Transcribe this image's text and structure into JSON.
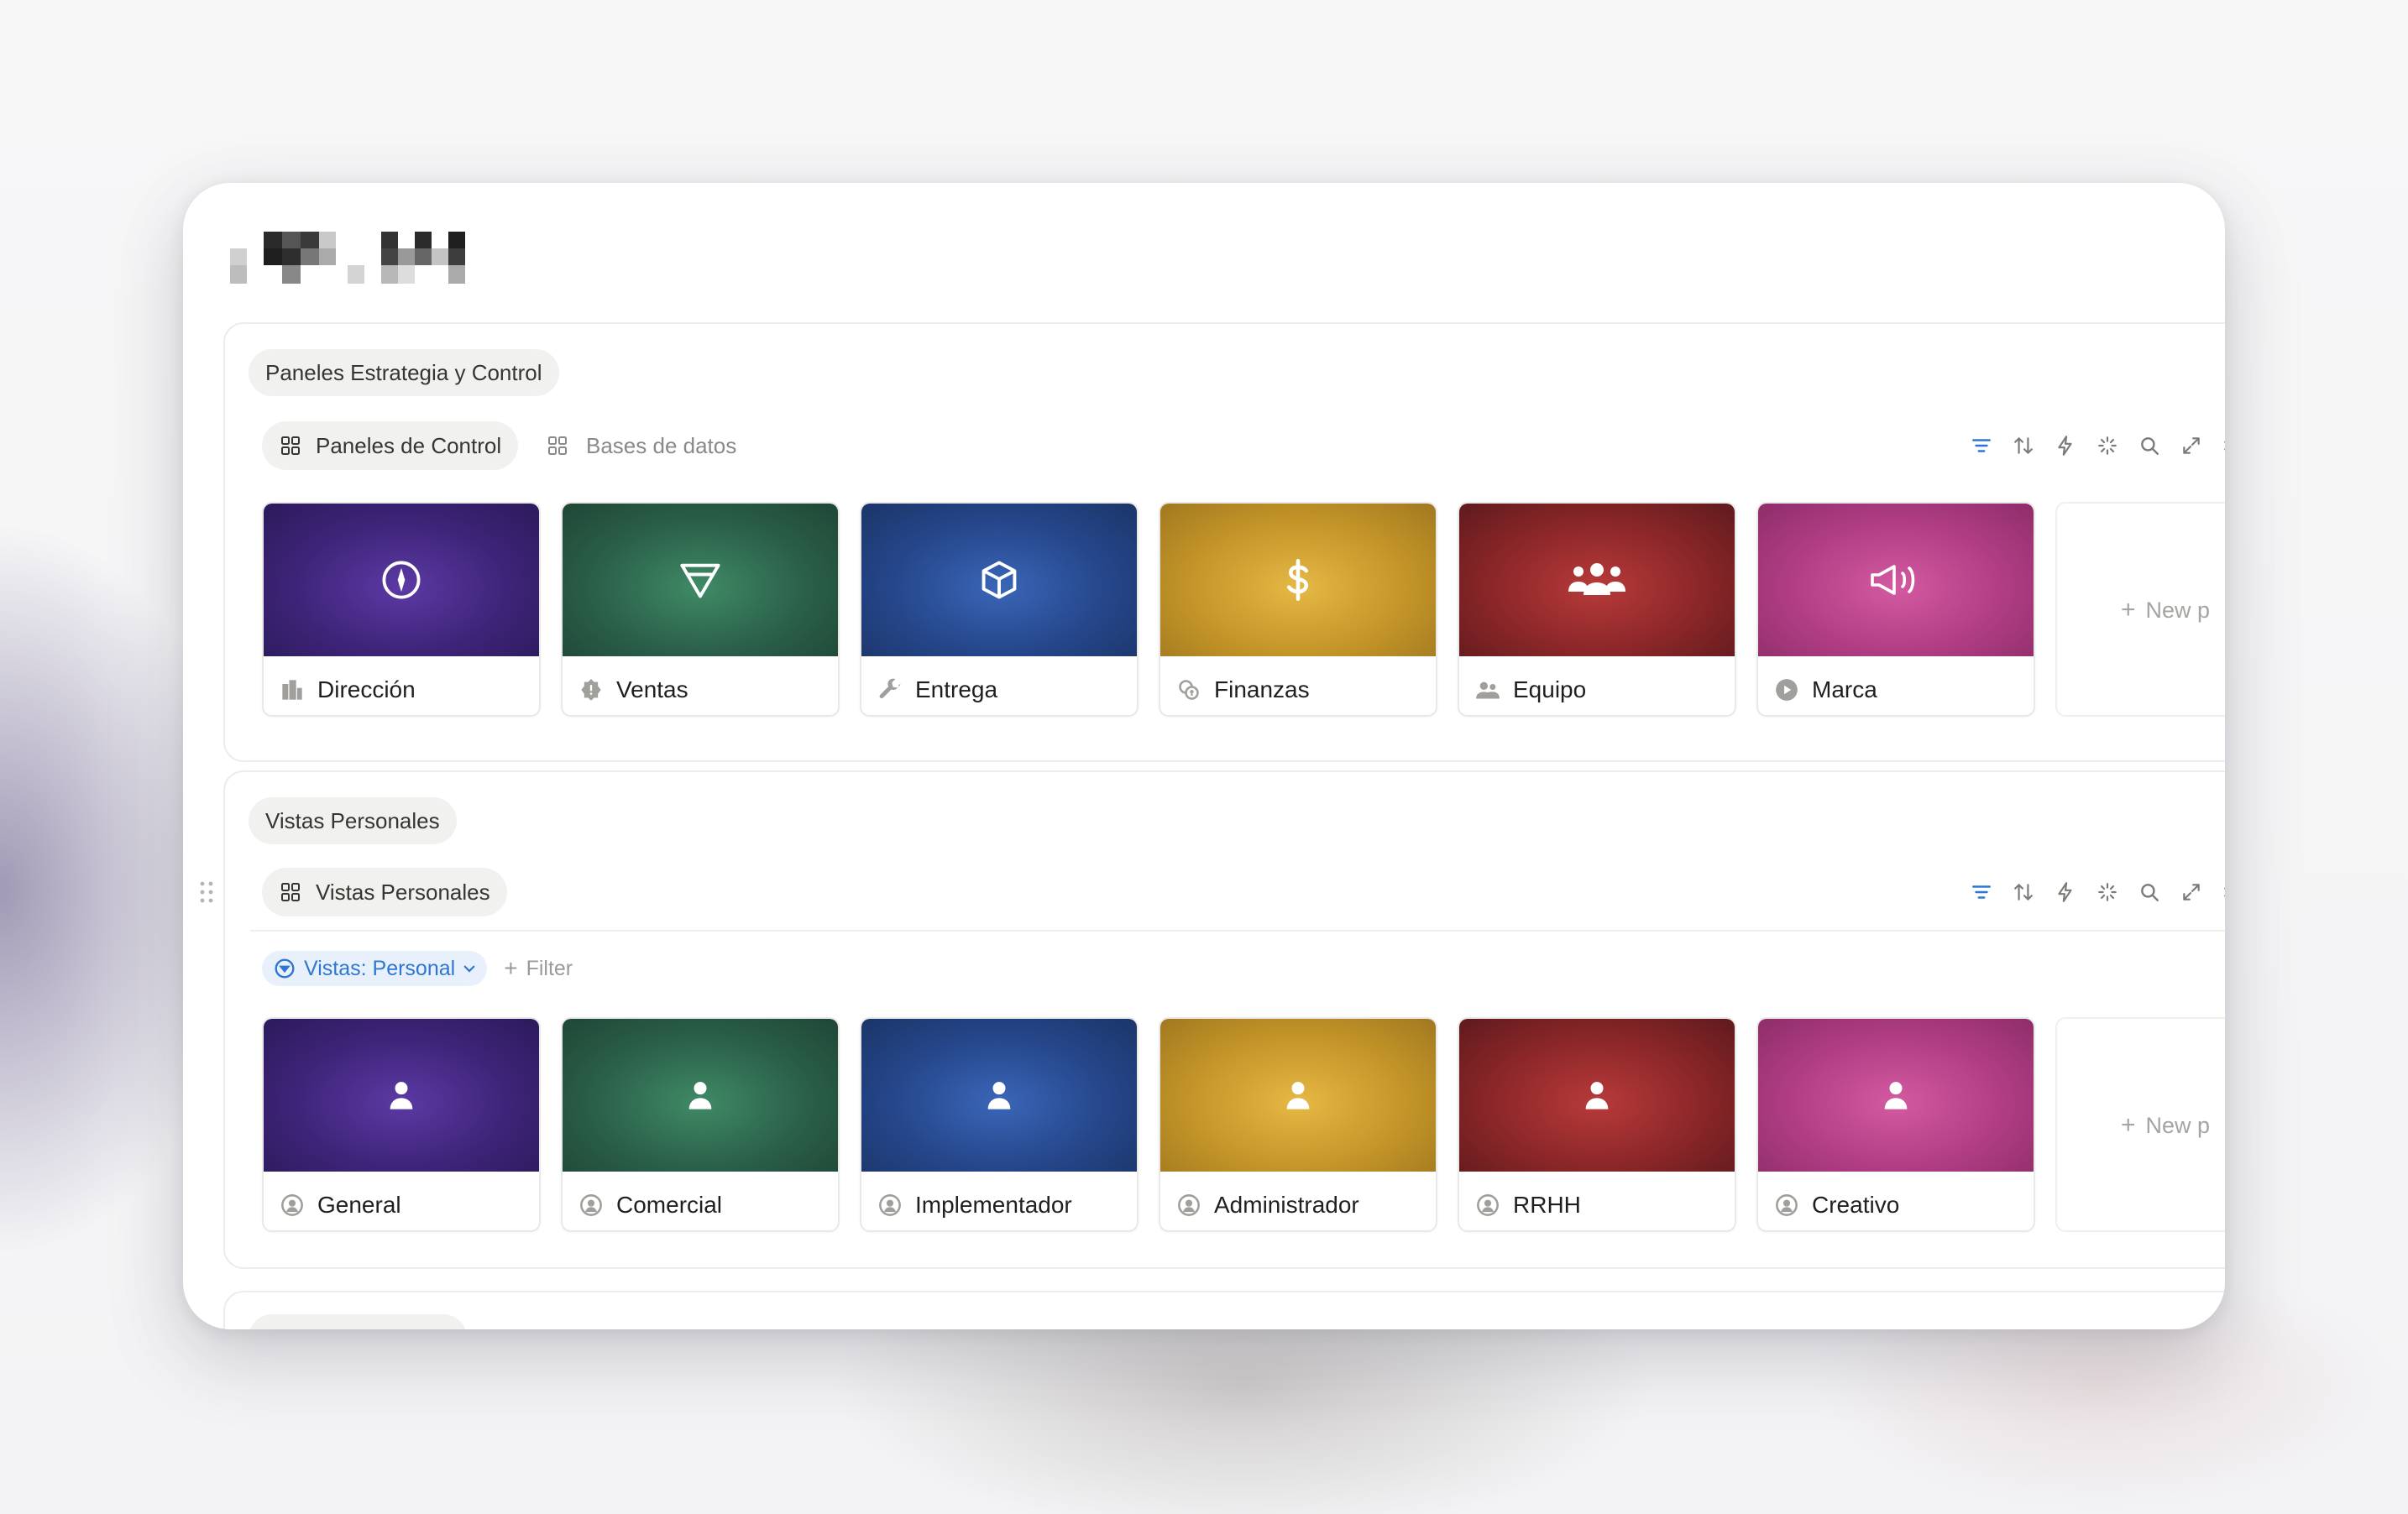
{
  "sections": [
    {
      "heading": "Paneles Estrategia y Control",
      "tabs": [
        {
          "label": "Paneles de Control",
          "active": true
        },
        {
          "label": "Bases de datos",
          "active": false
        }
      ],
      "cards": [
        {
          "title": "Dirección",
          "color": "purple",
          "icon": "compass-icon",
          "title_icon": "building-icon"
        },
        {
          "title": "Ventas",
          "color": "green",
          "icon": "funnel-icon",
          "title_icon": "badge-icon"
        },
        {
          "title": "Entrega",
          "color": "blue",
          "icon": "cube-icon",
          "title_icon": "wrench-icon"
        },
        {
          "title": "Finanzas",
          "color": "gold",
          "icon": "dollar-icon",
          "title_icon": "coins-icon"
        },
        {
          "title": "Equipo",
          "color": "red",
          "icon": "people-group-icon",
          "title_icon": "people-icon"
        },
        {
          "title": "Marca",
          "color": "pink",
          "icon": "megaphone-icon",
          "title_icon": "play-icon"
        }
      ],
      "new_label": "New p"
    },
    {
      "heading": "Vistas Personales",
      "tabs": [
        {
          "label": "Vistas Personales",
          "active": true
        }
      ],
      "filter_chip": "Vistas: Personal",
      "add_filter": "Filter",
      "cards": [
        {
          "title": "General",
          "color": "purple",
          "icon": "person-icon",
          "title_icon": "user-circle-icon"
        },
        {
          "title": "Comercial",
          "color": "green",
          "icon": "person-icon",
          "title_icon": "user-circle-icon"
        },
        {
          "title": "Implementador",
          "color": "blue",
          "icon": "person-icon",
          "title_icon": "user-circle-icon"
        },
        {
          "title": "Administrador",
          "color": "gold",
          "icon": "person-icon",
          "title_icon": "user-circle-icon"
        },
        {
          "title": "RRHH",
          "color": "red",
          "icon": "person-icon",
          "title_icon": "user-circle-icon"
        },
        {
          "title": "Creativo",
          "color": "pink",
          "icon": "person-icon",
          "title_icon": "user-circle-icon"
        }
      ],
      "new_label": "New p"
    }
  ],
  "toolbar_icons": [
    "filter-icon",
    "sort-icon",
    "automation-icon",
    "ai-sparkle-icon",
    "search-icon",
    "expand-icon",
    "settings-icon"
  ],
  "colors": {
    "purple": "#3e2478",
    "green": "#2a5f49",
    "blue": "#25468a",
    "gold": "#c49528",
    "red": "#8a2628",
    "pink": "#b03d84",
    "accent": "#2f76d2",
    "toolbar_active": "#2f76d2",
    "toolbar": "#7b7a77"
  }
}
